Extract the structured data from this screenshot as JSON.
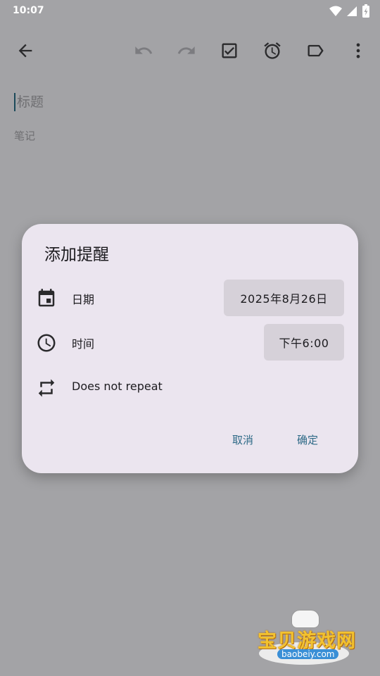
{
  "status": {
    "time": "10:07"
  },
  "note": {
    "title_placeholder": "标题",
    "body_placeholder": "笔记"
  },
  "dialog": {
    "title": "添加提醒",
    "date_label": "日期",
    "date_value": "2025年8月26日",
    "time_label": "时间",
    "time_value": "下午6:00",
    "repeat_label": "Does not repeat",
    "cancel": "取消",
    "confirm": "确定"
  },
  "watermark": {
    "brand": "宝贝游戏网",
    "url": "baobeiy.com"
  },
  "colors": {
    "dialog_bg": "#ebe5ef",
    "chip_bg": "#d6d1d9",
    "accent": "#2e6a87",
    "scrim": "#a3a3a6"
  }
}
